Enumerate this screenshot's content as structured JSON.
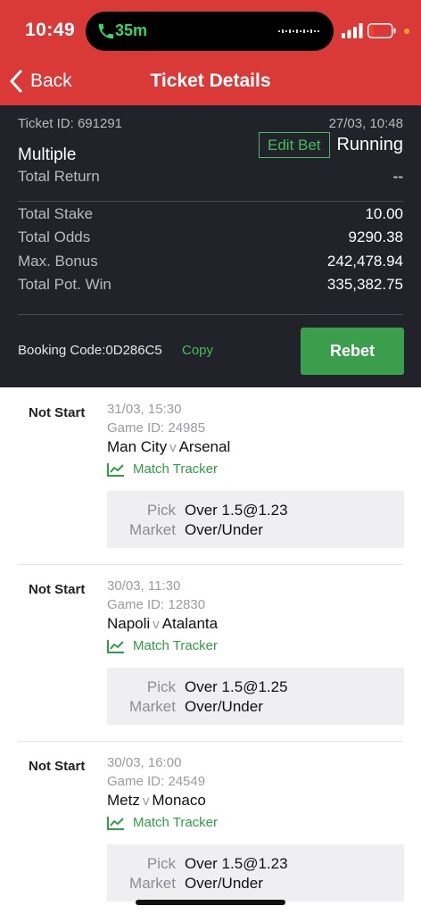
{
  "status_bar": {
    "time": "10:49",
    "call_duration": "35m"
  },
  "nav": {
    "back_label": "Back",
    "title": "Ticket Details"
  },
  "ticket": {
    "id_label": "Ticket ID: 691291",
    "datetime": "27/03, 10:48",
    "type": "Multiple",
    "edit_bet_label": "Edit Bet",
    "status": "Running",
    "total_return_label": "Total Return",
    "total_return_value": "--",
    "stats": [
      {
        "label": "Total Stake",
        "value": "10.00"
      },
      {
        "label": "Total Odds",
        "value": "9290.38"
      },
      {
        "label": "Max. Bonus",
        "value": "242,478.94"
      },
      {
        "label": "Total Pot. Win",
        "value": "335,382.75"
      }
    ],
    "booking_code": "Booking Code:0D286C5",
    "copy_label": "Copy",
    "rebet_label": "Rebet"
  },
  "bets": [
    {
      "status": "Not Start",
      "date": "31/03, 15:30",
      "game_id": "Game ID: 24985",
      "home": "Man City",
      "vs": "v",
      "away": "Arsenal",
      "tracker_label": "Match Tracker",
      "pick_label": "Pick",
      "pick_value": "Over 1.5@1.23",
      "market_label": "Market",
      "market_value": "Over/Under"
    },
    {
      "status": "Not Start",
      "date": "30/03, 11:30",
      "game_id": "Game ID: 12830",
      "home": "Napoli",
      "vs": "v",
      "away": "Atalanta",
      "tracker_label": "Match Tracker",
      "pick_label": "Pick",
      "pick_value": "Over 1.5@1.25",
      "market_label": "Market",
      "market_value": "Over/Under"
    },
    {
      "status": "Not Start",
      "date": "30/03, 16:00",
      "game_id": "Game ID: 24549",
      "home": "Metz",
      "vs": "v",
      "away": "Monaco",
      "tracker_label": "Match Tracker",
      "pick_label": "Pick",
      "pick_value": "Over 1.5@1.23",
      "market_label": "Market",
      "market_value": "Over/Under"
    }
  ],
  "colors": {
    "brand_red": "#d93a38",
    "panel_dark": "#22232a",
    "accent_green": "#3fbe59",
    "rebet_green": "#3a9e4c"
  }
}
